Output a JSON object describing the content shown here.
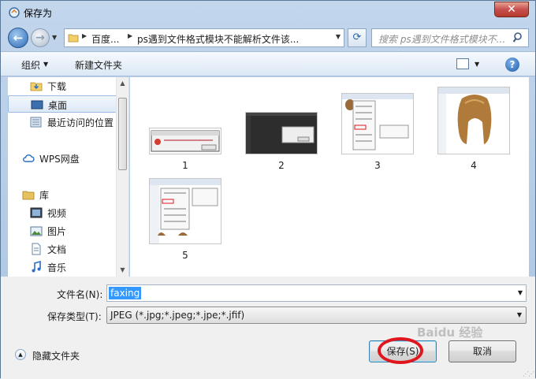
{
  "window": {
    "title": "保存为",
    "close_glyph": "✕"
  },
  "nav": {
    "back_glyph": "←",
    "forward_glyph": "→",
    "address_segments": [
      "百度...",
      "ps遇到文件格式模块不能解析文件该..."
    ],
    "refresh_glyph": "⟳",
    "search_placeholder": "搜索 ps遇到文件格式模块不..."
  },
  "toolbar": {
    "organize_label": "组织",
    "new_folder_label": "新建文件夹",
    "help_glyph": "?"
  },
  "sidebar": {
    "items": [
      {
        "label": "下载",
        "icon": "download-folder-icon"
      },
      {
        "label": "桌面",
        "icon": "desktop-icon"
      },
      {
        "label": "最近访问的位置",
        "icon": "recent-places-icon"
      },
      {
        "label": "WPS网盘",
        "icon": "cloud-icon"
      },
      {
        "label": "库",
        "icon": "library-icon"
      },
      {
        "label": "视频",
        "icon": "video-icon"
      },
      {
        "label": "图片",
        "icon": "picture-icon"
      },
      {
        "label": "文档",
        "icon": "document-icon"
      },
      {
        "label": "音乐",
        "icon": "music-icon"
      }
    ]
  },
  "files": [
    {
      "name": "1"
    },
    {
      "name": "2"
    },
    {
      "name": "3"
    },
    {
      "name": "4"
    },
    {
      "name": "5"
    }
  ],
  "form": {
    "filename_label": "文件名(N):",
    "filename_value": "faxing",
    "filetype_label": "保存类型(T):",
    "filetype_value": "JPEG (*.jpg;*.jpeg;*.jpe;*.jfif)",
    "hide_folders_label": "隐藏文件夹",
    "save_label": "保存(S)",
    "cancel_label": "取消"
  },
  "watermark": "Baidu 经验",
  "colors": {
    "highlight": "#e0161e",
    "selection": "#3399ff"
  }
}
